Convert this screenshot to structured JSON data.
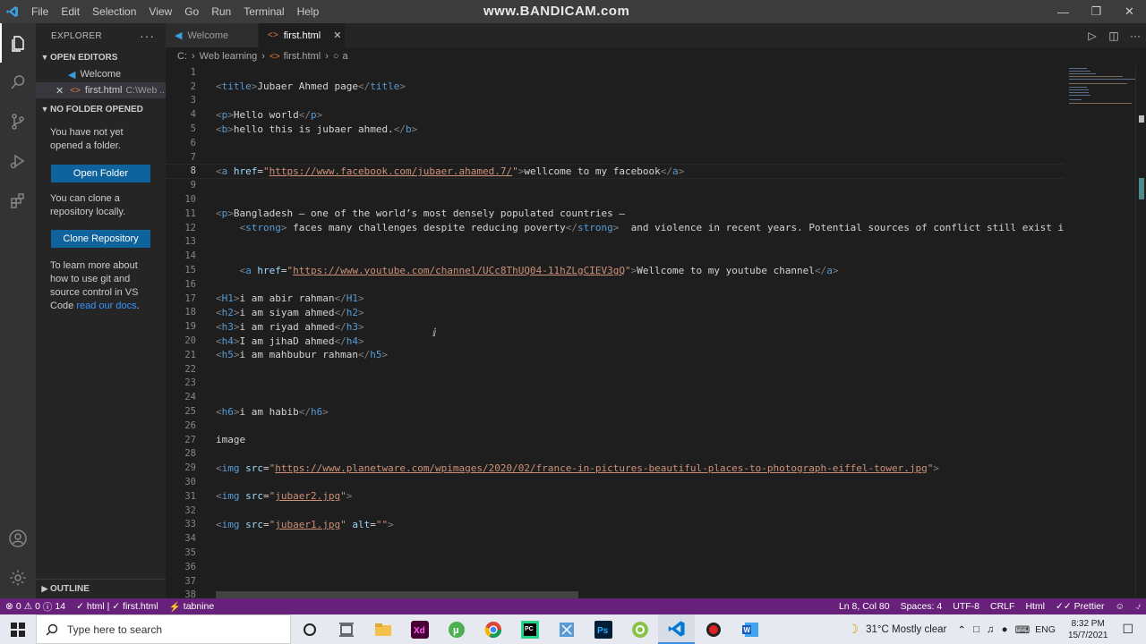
{
  "titlebar": {
    "menu": [
      "File",
      "Edit",
      "Selection",
      "View",
      "Go",
      "Run",
      "Terminal",
      "Help"
    ],
    "watermark": "www.BANDICAM.com"
  },
  "sidebar": {
    "title": "EXPLORER",
    "open_editors_label": "OPEN EDITORS",
    "open_editors": [
      {
        "name": "Welcome",
        "path": ""
      },
      {
        "name": "first.html",
        "path": "C:\\Web ..."
      }
    ],
    "no_folder_label": "NO FOLDER OPENED",
    "no_folder_text": "You have not yet opened a folder.",
    "open_folder_button": "Open Folder",
    "clone_text": "You can clone a repository locally.",
    "clone_button": "Clone Repository",
    "learn_text": "To learn more about how to use git and source control in VS Code",
    "learn_link": "read our docs",
    "learn_end": ".",
    "outline_label": "OUTLINE"
  },
  "tabs": [
    {
      "label": "Welcome",
      "active": false
    },
    {
      "label": "first.html",
      "active": true
    }
  ],
  "breadcrumb": [
    "C:",
    "Web learning",
    "first.html",
    "a"
  ],
  "editor": {
    "current_line": 8,
    "lines": [
      {
        "n": 1,
        "t": ""
      },
      {
        "n": 2,
        "t": "<title>Jubaer Ahmed page</title>"
      },
      {
        "n": 3,
        "t": ""
      },
      {
        "n": 4,
        "t": "<p>Hello world</p>"
      },
      {
        "n": 5,
        "t": "<b>hello this is jubaer ahmed.</b>"
      },
      {
        "n": 6,
        "t": ""
      },
      {
        "n": 7,
        "t": ""
      },
      {
        "n": 8,
        "t": "<a href=\"https://www.facebook.com/jubaer.ahamed.7/\">wellcome to my facebook</a>"
      },
      {
        "n": 9,
        "t": ""
      },
      {
        "n": 10,
        "t": ""
      },
      {
        "n": 11,
        "t": "<p>Bangladesh – one of the world’s most densely populated countries –"
      },
      {
        "n": 12,
        "t": "    <strong> faces many challenges despite reducing poverty</strong>  and violence in recent years. Potential sources of conflict still exist in the"
      },
      {
        "n": 13,
        "t": ""
      },
      {
        "n": 14,
        "t": ""
      },
      {
        "n": 15,
        "t": "    <a href=\"https://www.youtube.com/channel/UCc8ThUQ04-11hZLgCIEV3gQ\">Wellcome to my youtube channel</a>"
      },
      {
        "n": 16,
        "t": ""
      },
      {
        "n": 17,
        "t": "<H1>i am abir rahman</H1>"
      },
      {
        "n": 18,
        "t": "<h2>i am siyam ahmed</h2>"
      },
      {
        "n": 19,
        "t": "<h3>i am riyad ahmed</h3>"
      },
      {
        "n": 20,
        "t": "<h4>I am jihaD ahmed</h4>"
      },
      {
        "n": 21,
        "t": "<h5>i am mahbubur rahman</h5>"
      },
      {
        "n": 22,
        "t": ""
      },
      {
        "n": 23,
        "t": ""
      },
      {
        "n": 24,
        "t": ""
      },
      {
        "n": 25,
        "t": "<h6>i am habib</h6>"
      },
      {
        "n": 26,
        "t": ""
      },
      {
        "n": 27,
        "t": "image"
      },
      {
        "n": 28,
        "t": ""
      },
      {
        "n": 29,
        "t": "<img src=\"https://www.planetware.com/wpimages/2020/02/france-in-pictures-beautiful-places-to-photograph-eiffel-tower.jpg\">"
      },
      {
        "n": 30,
        "t": ""
      },
      {
        "n": 31,
        "t": "<img src=\"jubaer2.jpg\">"
      },
      {
        "n": 32,
        "t": ""
      },
      {
        "n": 33,
        "t": "<img src=\"jubaer1.jpg\" alt=\"\">"
      },
      {
        "n": 34,
        "t": ""
      },
      {
        "n": 35,
        "t": ""
      },
      {
        "n": 36,
        "t": ""
      },
      {
        "n": 37,
        "t": ""
      },
      {
        "n": 38,
        "t": ""
      }
    ]
  },
  "statusbar": {
    "errors": "0",
    "warnings": "0",
    "info": "14",
    "checks": "html | ✓ first.html",
    "tabnine": "tabnine",
    "position": "Ln 8, Col 80",
    "spaces": "Spaces: 4",
    "encoding": "UTF-8",
    "eol": "CRLF",
    "language": "Html",
    "prettier": "Prettier"
  },
  "taskbar": {
    "search_placeholder": "Type here to search",
    "weather": "31°C  Mostly clear",
    "lang": "ENG",
    "time": "8:32 PM",
    "date": "15/7/2021",
    "apps": [
      "cortana-icon",
      "task-view-icon",
      "file-explorer-icon",
      "adobe-xd-icon",
      "utorrent-icon",
      "chrome-icon",
      "pycharm-icon",
      "snipping-tool-icon",
      "photoshop-icon",
      "android-icon",
      "vscode-icon",
      "bandicam-icon",
      "word-icon"
    ]
  },
  "colors": {
    "accent": "#68217a",
    "tag": "#569cd6",
    "attr": "#9cdcfe",
    "string": "#ce9178",
    "text": "#d4d4d4"
  }
}
